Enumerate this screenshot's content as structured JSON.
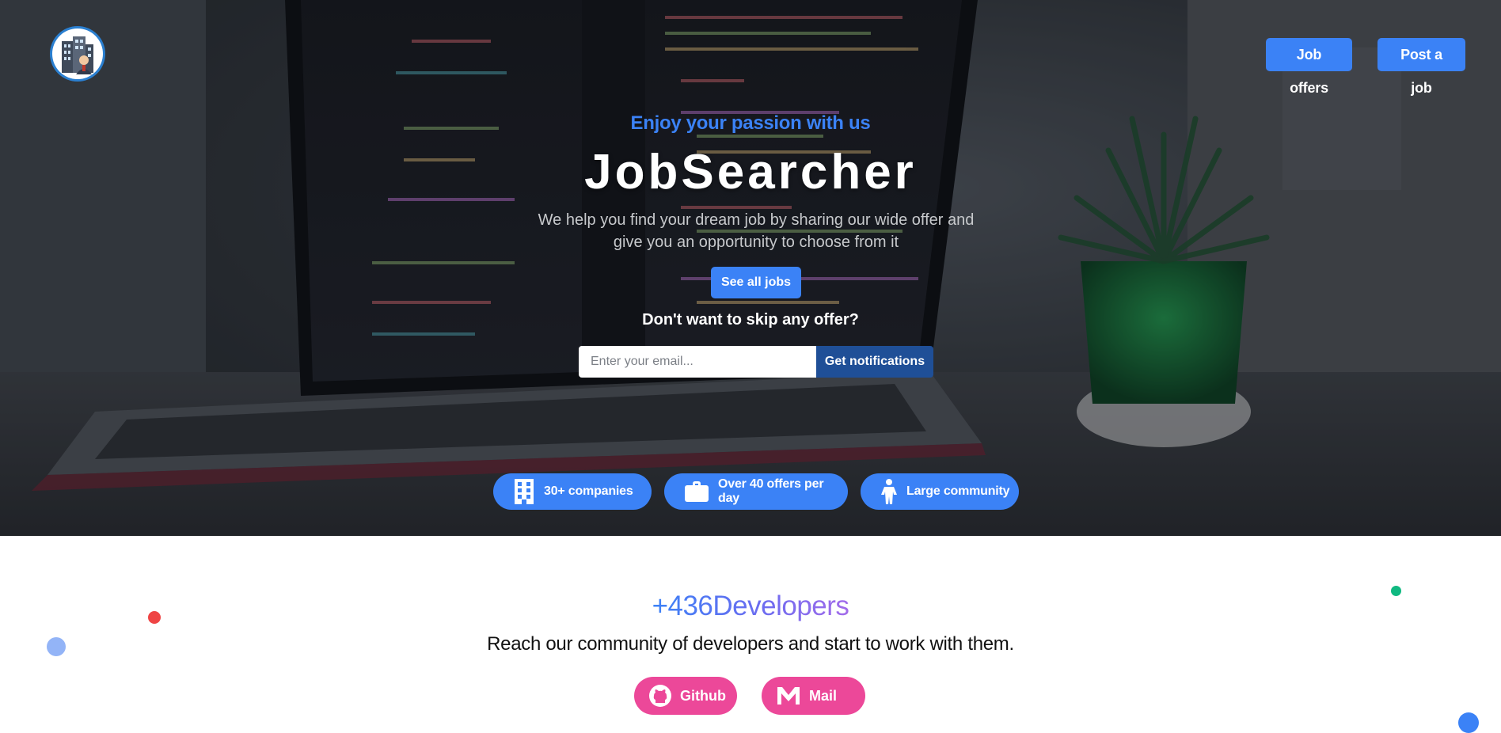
{
  "header": {
    "logo_icon": "office-building-with-person-icon",
    "nav": {
      "job_offers": "Job offers",
      "post_job": "Post a job"
    }
  },
  "hero": {
    "tagline": "Enjoy your passion with us",
    "brand": "JobSearcher",
    "description": "We help you find your dream job by sharing our wide offer and give you an opportunity to choose from it",
    "see_all_jobs": "See all jobs",
    "skip_heading": "Don't want to skip any offer?",
    "email": {
      "placeholder": "Enter your email...",
      "value": ""
    },
    "notify_button": "Get notifications",
    "features": [
      {
        "icon": "building-icon",
        "label": "30+ companies"
      },
      {
        "icon": "briefcase-icon",
        "label": "Over 40 offers per day"
      },
      {
        "icon": "person-icon",
        "label": "Large community"
      }
    ]
  },
  "developers": {
    "heading": "+436Developers",
    "subtitle": "Reach our community of developers and start to work with them.",
    "buttons": {
      "github": "Github",
      "mail": "Mail"
    }
  },
  "colors": {
    "primary": "#3b82f6",
    "accent_pink": "#ec4899",
    "notify_dark": "#1f4f97",
    "hero_background": "#2f3339",
    "dot_red": "#ef4444",
    "dot_blue": "#93b4f7",
    "dot_green": "#10b981",
    "dot_blue_bright": "#3b82f6"
  }
}
